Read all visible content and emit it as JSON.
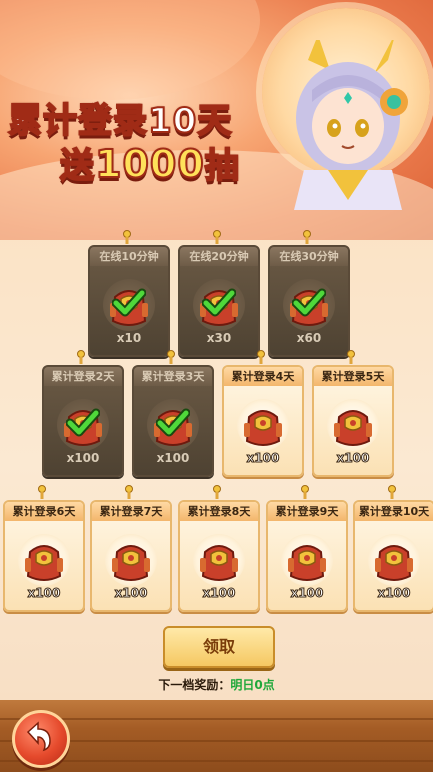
{
  "banner": {
    "line1": "累计登录10天",
    "line2_prefix": "送",
    "line2_big": "1000",
    "line2_suffix": "抽"
  },
  "rows": [
    [
      {
        "label": "在线10分钟",
        "qty": "x10",
        "done": true
      },
      {
        "label": "在线20分钟",
        "qty": "x30",
        "done": true
      },
      {
        "label": "在线30分钟",
        "qty": "x60",
        "done": true
      }
    ],
    [
      {
        "label": "累计登录2天",
        "qty": "x100",
        "done": true
      },
      {
        "label": "累计登录3天",
        "qty": "x100",
        "done": true
      },
      {
        "label": "累计登录4天",
        "qty": "x100",
        "done": false
      },
      {
        "label": "累计登录5天",
        "qty": "x100",
        "done": false
      }
    ],
    [
      {
        "label": "累计登录6天",
        "qty": "x100",
        "done": false
      },
      {
        "label": "累计登录7天",
        "qty": "x100",
        "done": false
      },
      {
        "label": "累计登录8天",
        "qty": "x100",
        "done": false
      },
      {
        "label": "累计登录9天",
        "qty": "x100",
        "done": false
      },
      {
        "label": "累计登录10天",
        "qty": "x100",
        "done": false
      }
    ]
  ],
  "claim_button": "领取",
  "next_reward": {
    "label": "下一档奖励：",
    "value": "明日0点"
  },
  "icons": {
    "back": "back-arrow-icon",
    "check": "check-icon",
    "pack": "reward-pack-icon"
  }
}
